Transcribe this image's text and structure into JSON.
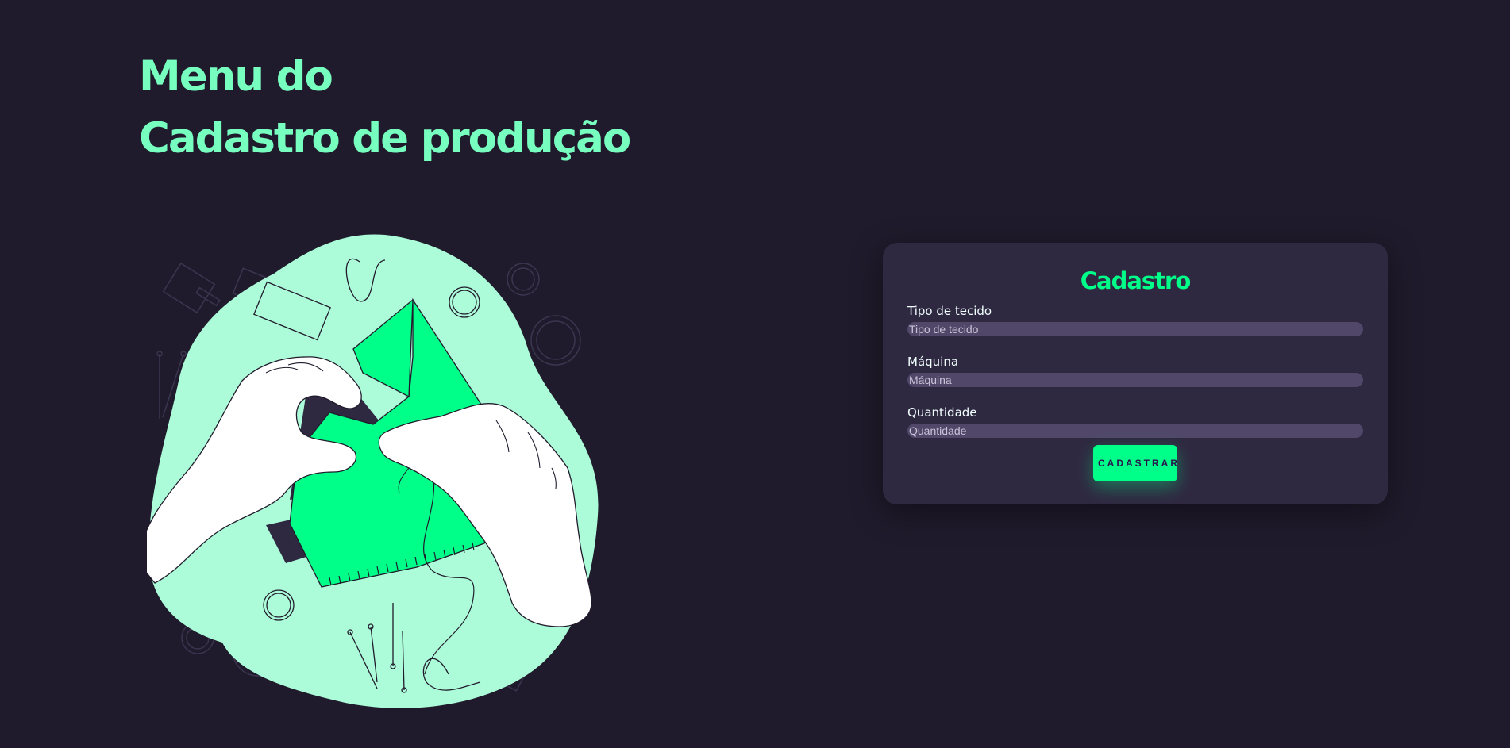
{
  "heading": {
    "line1": "Menu do",
    "line2": "Cadastro de produção"
  },
  "illustration": {
    "icon": "sewing-hands-illustration"
  },
  "form": {
    "title": "Cadastro",
    "fields": [
      {
        "label": "Tipo de tecido",
        "placeholder": "Tipo de tecido",
        "value": ""
      },
      {
        "label": "Máquina",
        "placeholder": "Máquina",
        "value": ""
      },
      {
        "label": "Quantidade",
        "placeholder": "Quantidade",
        "value": ""
      }
    ],
    "submit_label": "CADASTRAR"
  },
  "colors": {
    "background": "#201b2c",
    "heading": "#77ffc0",
    "accent": "#00ff88",
    "card": "#2f2841",
    "input": "#514869"
  }
}
